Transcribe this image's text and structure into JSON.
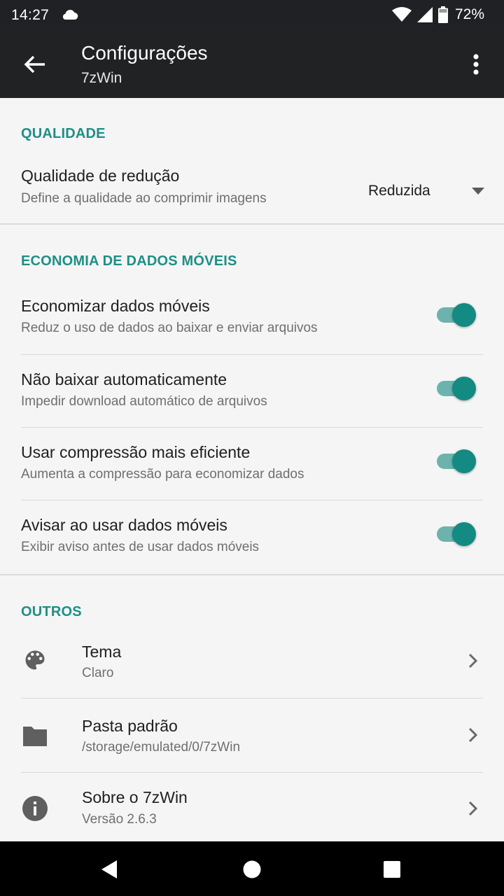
{
  "status_bar": {
    "time": "14:27",
    "battery_percent": "72%",
    "icons": [
      "cloud-icon",
      "wifi-icon",
      "signal-icon",
      "battery-icon"
    ]
  },
  "app_bar": {
    "title": "Configurações",
    "subtitle": "7zWin",
    "back_icon": "arrow-back-icon",
    "menu_icon": "more-vert-icon"
  },
  "sections": {
    "quality": {
      "header": "QUALIDADE",
      "item": {
        "title": "Qualidade de redução",
        "summary": "Define a qualidade ao comprimir imagens",
        "selected_value": "Reduzida"
      }
    },
    "data_saving": {
      "header": "ECONOMIA DE DADOS MÓVEIS",
      "items": [
        {
          "title": "Economizar dados móveis",
          "summary": "Reduz o uso de dados ao baixar e enviar arquivos",
          "enabled": true
        },
        {
          "title": "Não baixar automaticamente",
          "summary": "Impedir download automático de arquivos",
          "enabled": true
        },
        {
          "title": "Usar compressão mais eficiente",
          "summary": "Aumenta a compressão para economizar dados",
          "enabled": true
        },
        {
          "title": "Avisar ao usar dados móveis",
          "summary": "Exibir aviso antes de usar dados móveis",
          "enabled": true
        }
      ]
    },
    "others": {
      "header": "OUTROS",
      "items": [
        {
          "icon": "palette-icon",
          "title": "Tema",
          "summary": "Claro"
        },
        {
          "icon": "folder-icon",
          "title": "Pasta padrão",
          "summary": "/storage/emulated/0/7zWin"
        },
        {
          "icon": "info-icon",
          "title": "Sobre o 7zWin",
          "summary": "Versão 2.6.3"
        }
      ]
    }
  },
  "colors": {
    "accent": "#1e8f86",
    "switch_thumb": "#138a82",
    "switch_track": "#6cb3ad",
    "app_bar": "#212224",
    "status_bar": "#1f2124",
    "background": "#f5f5f5"
  },
  "nav_bar": {
    "buttons": [
      "nav-back-icon",
      "nav-home-icon",
      "nav-recents-icon"
    ]
  }
}
